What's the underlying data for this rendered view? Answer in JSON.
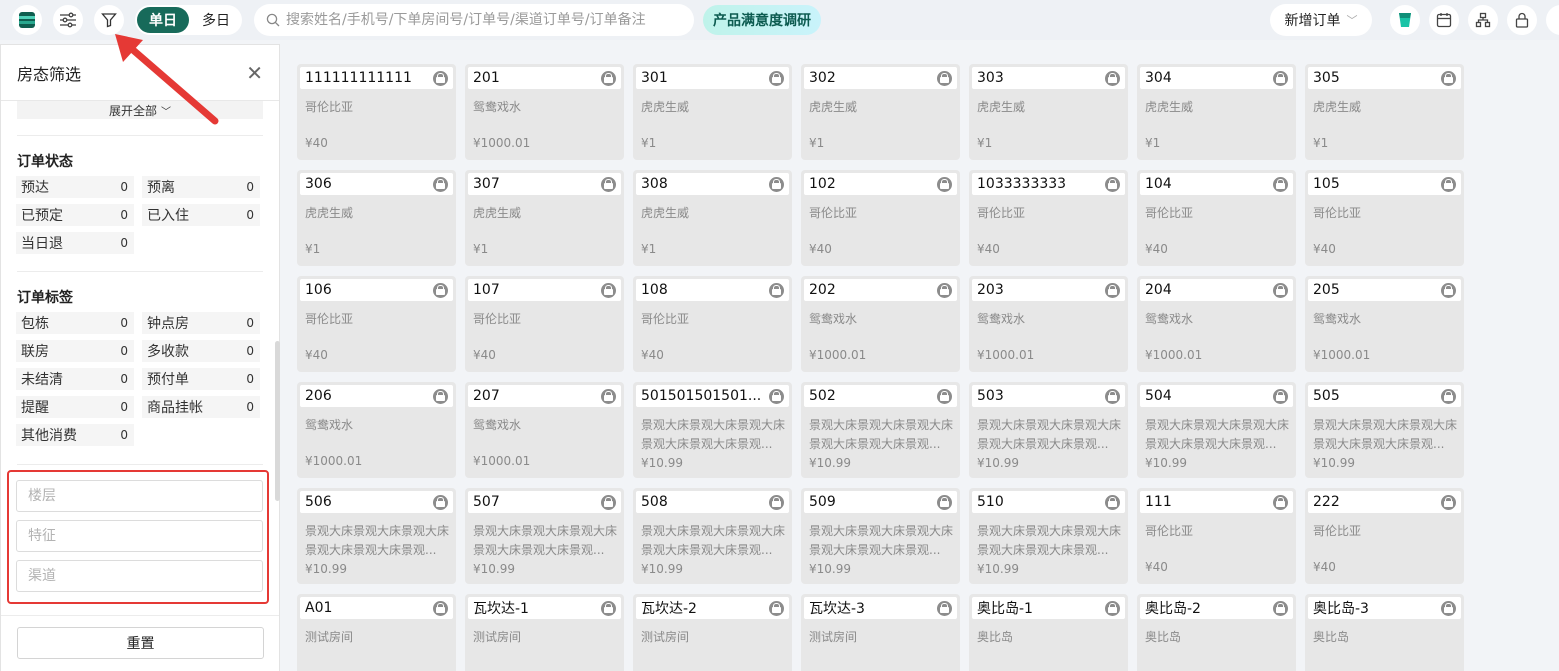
{
  "toolbar": {
    "seg_single": "单日",
    "seg_multi": "多日",
    "search_placeholder": "搜索姓名/手机号/下单房间号/订单号/渠道订单号/订单备注",
    "survey_label": "产品满意度调研",
    "new_order_label": "新增订单"
  },
  "panel": {
    "title": "房态筛选",
    "expand_all": "展开全部",
    "order_status": {
      "title": "订单状态",
      "items": [
        {
          "label": "预达",
          "count": "0"
        },
        {
          "label": "预离",
          "count": "0"
        },
        {
          "label": "已预定",
          "count": "0"
        },
        {
          "label": "已入住",
          "count": "0"
        },
        {
          "label": "当日退",
          "count": "0"
        }
      ]
    },
    "order_tags": {
      "title": "订单标签",
      "items": [
        {
          "label": "包栋",
          "count": "0"
        },
        {
          "label": "钟点房",
          "count": "0"
        },
        {
          "label": "联房",
          "count": "0"
        },
        {
          "label": "多收款",
          "count": "0"
        },
        {
          "label": "未结清",
          "count": "0"
        },
        {
          "label": "预付单",
          "count": "0"
        },
        {
          "label": "提醒",
          "count": "0"
        },
        {
          "label": "商品挂帐",
          "count": "0"
        },
        {
          "label": "其他消费",
          "count": "0"
        }
      ]
    },
    "fields": {
      "floor_placeholder": "楼层",
      "feature_placeholder": "特征",
      "channel_placeholder": "渠道"
    },
    "reset_label": "重置"
  },
  "rooms": [
    {
      "num": "111111111111",
      "type": "哥伦比亚",
      "price": "¥40"
    },
    {
      "num": "201",
      "type": "鸳鸯戏水",
      "price": "¥1000.01"
    },
    {
      "num": "301",
      "type": "虎虎生威",
      "price": "¥1"
    },
    {
      "num": "302",
      "type": "虎虎生威",
      "price": "¥1"
    },
    {
      "num": "303",
      "type": "虎虎生威",
      "price": "¥1"
    },
    {
      "num": "304",
      "type": "虎虎生威",
      "price": "¥1"
    },
    {
      "num": "305",
      "type": "虎虎生威",
      "price": "¥1"
    },
    {
      "num": "306",
      "type": "虎虎生威",
      "price": "¥1"
    },
    {
      "num": "307",
      "type": "虎虎生威",
      "price": "¥1"
    },
    {
      "num": "308",
      "type": "虎虎生威",
      "price": "¥1"
    },
    {
      "num": "102",
      "type": "哥伦比亚",
      "price": "¥40"
    },
    {
      "num": "1033333333",
      "type": "哥伦比亚",
      "price": "¥40"
    },
    {
      "num": "104",
      "type": "哥伦比亚",
      "price": "¥40"
    },
    {
      "num": "105",
      "type": "哥伦比亚",
      "price": "¥40"
    },
    {
      "num": "106",
      "type": "哥伦比亚",
      "price": "¥40"
    },
    {
      "num": "107",
      "type": "哥伦比亚",
      "price": "¥40"
    },
    {
      "num": "108",
      "type": "哥伦比亚",
      "price": "¥40"
    },
    {
      "num": "202",
      "type": "鸳鸯戏水",
      "price": "¥1000.01"
    },
    {
      "num": "203",
      "type": "鸳鸯戏水",
      "price": "¥1000.01"
    },
    {
      "num": "204",
      "type": "鸳鸯戏水",
      "price": "¥1000.01"
    },
    {
      "num": "205",
      "type": "鸳鸯戏水",
      "price": "¥1000.01"
    },
    {
      "num": "206",
      "type": "鸳鸯戏水",
      "price": "¥1000.01"
    },
    {
      "num": "207",
      "type": "鸳鸯戏水",
      "price": "¥1000.01"
    },
    {
      "num": "501501501501...",
      "type": "景观大床景观大床景观大床景观大床景观大床景观...",
      "price": "¥10.99"
    },
    {
      "num": "502",
      "type": "景观大床景观大床景观大床景观大床景观大床景观...",
      "price": "¥10.99"
    },
    {
      "num": "503",
      "type": "景观大床景观大床景观大床景观大床景观大床景观...",
      "price": "¥10.99"
    },
    {
      "num": "504",
      "type": "景观大床景观大床景观大床景观大床景观大床景观...",
      "price": "¥10.99"
    },
    {
      "num": "505",
      "type": "景观大床景观大床景观大床景观大床景观大床景观...",
      "price": "¥10.99"
    },
    {
      "num": "506",
      "type": "景观大床景观大床景观大床景观大床景观大床景观...",
      "price": "¥10.99"
    },
    {
      "num": "507",
      "type": "景观大床景观大床景观大床景观大床景观大床景观...",
      "price": "¥10.99"
    },
    {
      "num": "508",
      "type": "景观大床景观大床景观大床景观大床景观大床景观...",
      "price": "¥10.99"
    },
    {
      "num": "509",
      "type": "景观大床景观大床景观大床景观大床景观大床景观...",
      "price": "¥10.99"
    },
    {
      "num": "510",
      "type": "景观大床景观大床景观大床景观大床景观大床景观...",
      "price": "¥10.99"
    },
    {
      "num": "111",
      "type": "哥伦比亚",
      "price": "¥40"
    },
    {
      "num": "222",
      "type": "哥伦比亚",
      "price": "¥40"
    },
    {
      "num": "A01",
      "type": "测试房间",
      "price": ""
    },
    {
      "num": "瓦坎达-1",
      "type": "测试房间",
      "price": ""
    },
    {
      "num": "瓦坎达-2",
      "type": "测试房间",
      "price": ""
    },
    {
      "num": "瓦坎达-3",
      "type": "测试房间",
      "price": ""
    },
    {
      "num": "奥比岛-1",
      "type": "奥比岛",
      "price": ""
    },
    {
      "num": "奥比岛-2",
      "type": "奥比岛",
      "price": ""
    },
    {
      "num": "奥比岛-3",
      "type": "奥比岛",
      "price": ""
    }
  ],
  "colors": {
    "brand": "#176a5a",
    "annotation": "#e53935"
  }
}
